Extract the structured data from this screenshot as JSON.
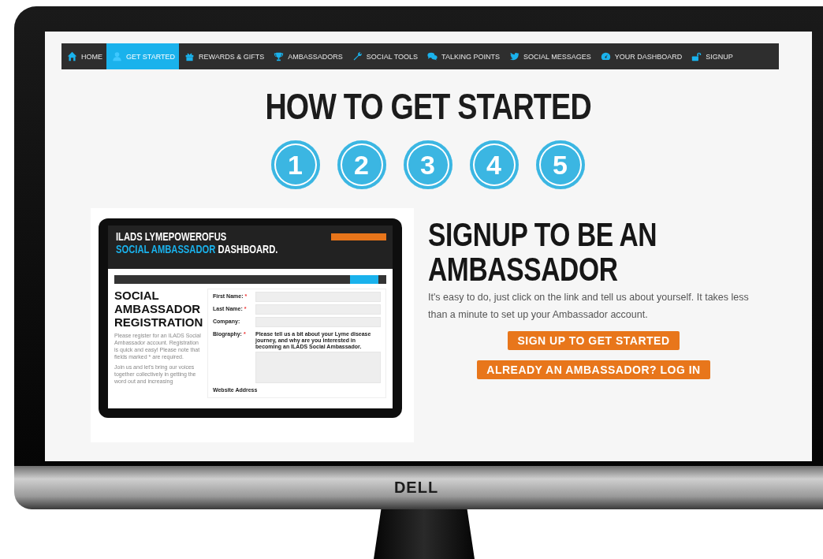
{
  "nav": [
    {
      "label": "HOME",
      "selected": false
    },
    {
      "label": "GET STARTED",
      "selected": true
    },
    {
      "label": "REWARDS & GIFTS",
      "selected": false
    },
    {
      "label": "AMBASSADORS",
      "selected": false
    },
    {
      "label": "SOCIAL TOOLS",
      "selected": false
    },
    {
      "label": "TALKING POINTS",
      "selected": false
    },
    {
      "label": "SOCIAL MESSAGES",
      "selected": false
    },
    {
      "label": "YOUR DASHBOARD",
      "selected": false
    },
    {
      "label": "SIGNUP",
      "selected": false
    }
  ],
  "heading": "HOW TO GET STARTED",
  "steps": [
    "1",
    "2",
    "3",
    "4",
    "5"
  ],
  "preview": {
    "title": "ILADS LYMEPOWEROFUS",
    "subtitle_highlight": "SOCIAL AMBASSADOR",
    "subtitle_rest": "DASHBOARD.",
    "heading": "SOCIAL AMBASSADOR REGISTRATION",
    "paragraphs": [
      "Please register for an ILADS Social Ambassador account. Registration is quick and easy! Please note that fields marked * are required.",
      "Join us and let's bring our voices together collectively in getting the word out and increasing"
    ],
    "fields": [
      {
        "kind": "input",
        "label": "First Name:",
        "mark": "*"
      },
      {
        "kind": "input",
        "label": "Last Name:",
        "mark": "*"
      },
      {
        "kind": "input",
        "label": "Company:"
      },
      {
        "kind": "textarea",
        "label": "Biography:",
        "mark": "*",
        "hint": "Please tell us a bit about your Lyme disease journey, and why are you interested in becoming an ILADS Social Ambassador."
      },
      {
        "kind": "label",
        "label": "Website Address"
      }
    ]
  },
  "signup": {
    "heading": "SIGNUP TO BE AN AMBASSADOR",
    "text": "It's easy to do, just click on the link and tell us about yourself. It takes less than a minute to set up your Ambassador account.",
    "buttons": [
      "SIGN UP TO GET STARTED",
      "ALREADY AN AMBASSADOR? LOG IN"
    ]
  },
  "monitor": {
    "brand": "DELL"
  }
}
